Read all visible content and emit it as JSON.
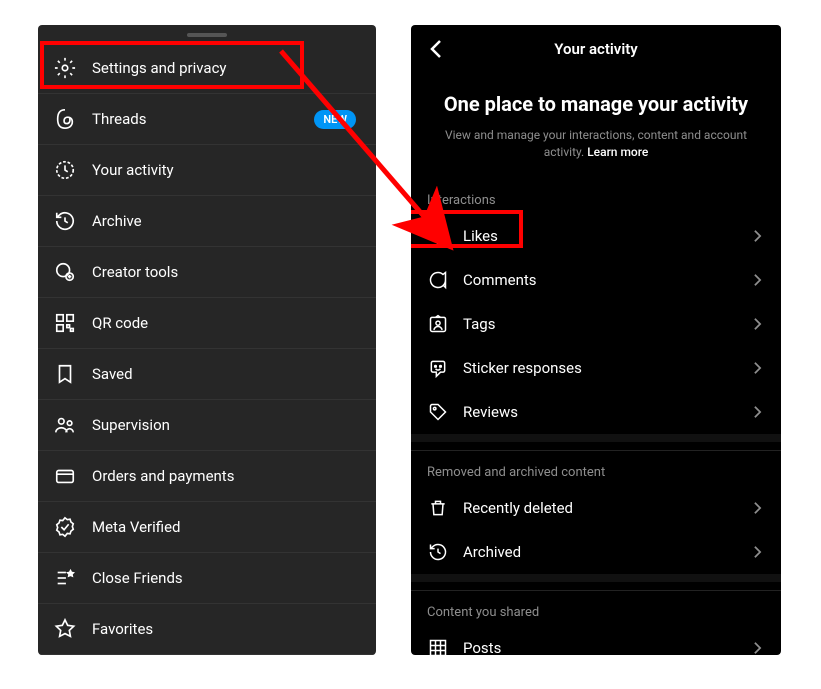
{
  "left_panel": {
    "items": [
      {
        "label": "Settings and privacy"
      },
      {
        "label": "Threads",
        "badge": "NEW"
      },
      {
        "label": "Your activity"
      },
      {
        "label": "Archive"
      },
      {
        "label": "Creator tools"
      },
      {
        "label": "QR code"
      },
      {
        "label": "Saved"
      },
      {
        "label": "Supervision"
      },
      {
        "label": "Orders and payments"
      },
      {
        "label": "Meta Verified"
      },
      {
        "label": "Close Friends"
      },
      {
        "label": "Favorites"
      }
    ]
  },
  "right_panel": {
    "header_title": "Your activity",
    "hero_title": "One place to manage your activity",
    "hero_sub_prefix": "View and manage your interactions, content and account activity. ",
    "hero_learn": "Learn more",
    "sections": {
      "interactions": {
        "label": "Interactions",
        "items": [
          {
            "label": "Likes"
          },
          {
            "label": "Comments"
          },
          {
            "label": "Tags"
          },
          {
            "label": "Sticker responses"
          },
          {
            "label": "Reviews"
          }
        ]
      },
      "removed": {
        "label": "Removed and archived content",
        "items": [
          {
            "label": "Recently deleted"
          },
          {
            "label": "Archived"
          }
        ]
      },
      "shared": {
        "label": "Content you shared",
        "items": [
          {
            "label": "Posts"
          }
        ]
      }
    }
  }
}
